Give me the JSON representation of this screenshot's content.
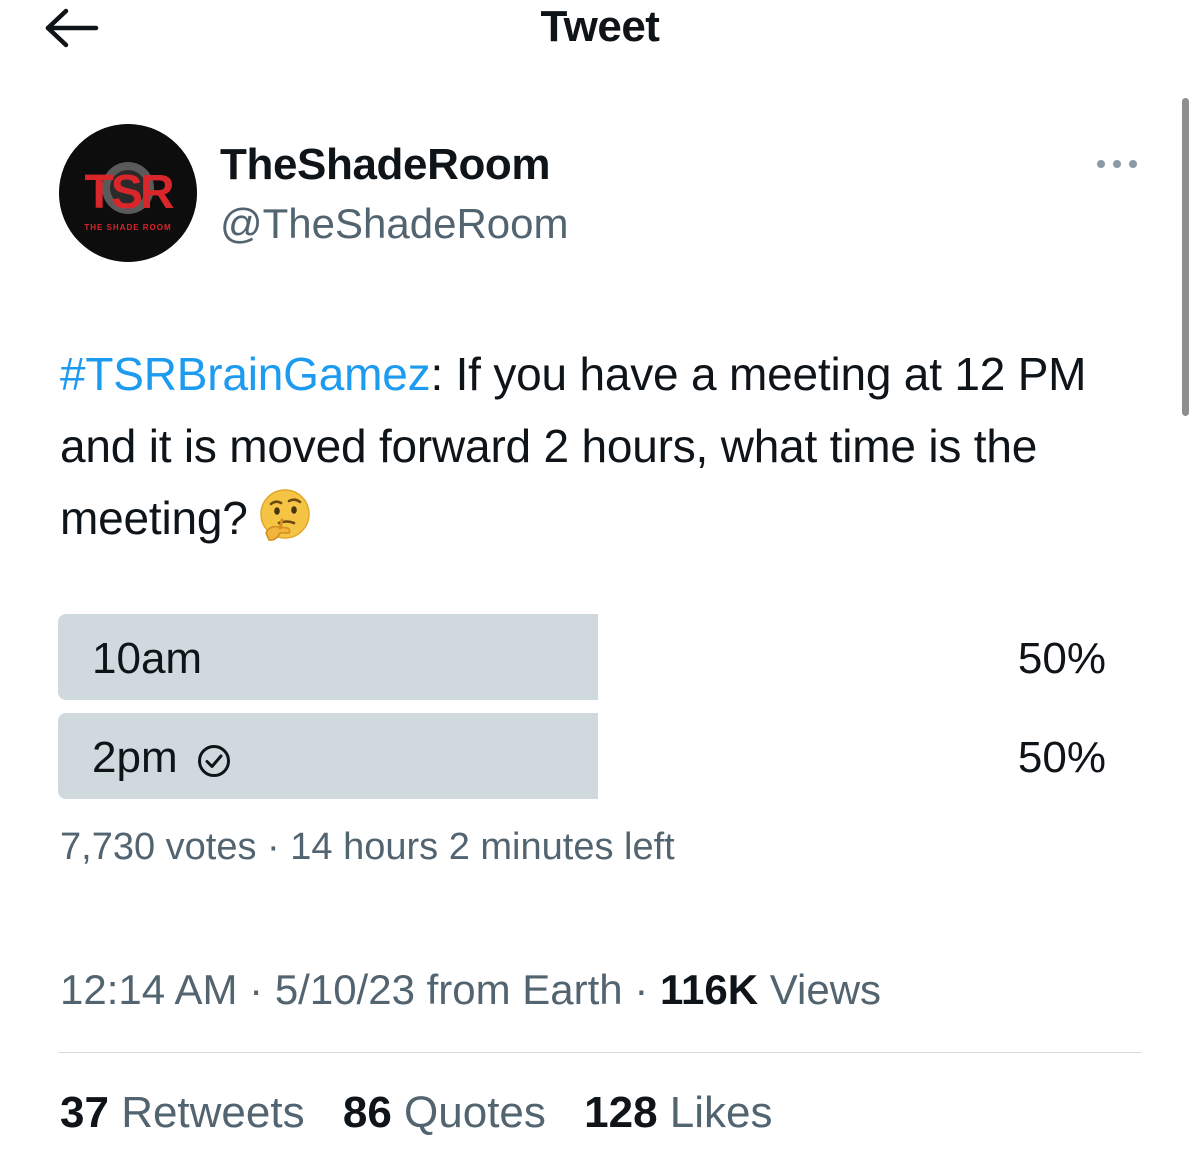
{
  "header": {
    "title": "Tweet",
    "back_icon": "arrow-left-icon"
  },
  "author": {
    "display_name": "TheShadeRoom",
    "handle": "@TheShadeRoom",
    "avatar_logo": "TSR",
    "avatar_tagline": "THE SHADE ROOM",
    "more_icon": "more-dots-icon"
  },
  "tweet": {
    "hashtag": "#TSRBrainGamez",
    "text": ": If you have a meeting at 12 PM and it is moved forward 2 hours, what time is the meeting?",
    "emoji": "thinking-face-emoji"
  },
  "poll": {
    "options": [
      {
        "label": "10am",
        "percent_label": "50%",
        "share": 0.5,
        "selected": false
      },
      {
        "label": "2pm",
        "percent_label": "50%",
        "share": 0.5,
        "selected": true
      }
    ],
    "votes": "7,730 votes",
    "separator": "·",
    "time_left": "14 hours 2 minutes left"
  },
  "meta": {
    "time": "12:14 AM",
    "date_source": "5/10/23 from Earth",
    "views_count": "116K",
    "views_label": "Views",
    "separator": "·"
  },
  "stats": {
    "retweets_count": "37",
    "retweets_label": "Retweets",
    "quotes_count": "86",
    "quotes_label": "Quotes",
    "likes_count": "128",
    "likes_label": "Likes"
  },
  "colors": {
    "link": "#1d9bf0",
    "poll_bar": "#cfd9de",
    "secondary_text": "#536471",
    "primary_text": "#0f1419",
    "logo_red": "#d9262b"
  }
}
